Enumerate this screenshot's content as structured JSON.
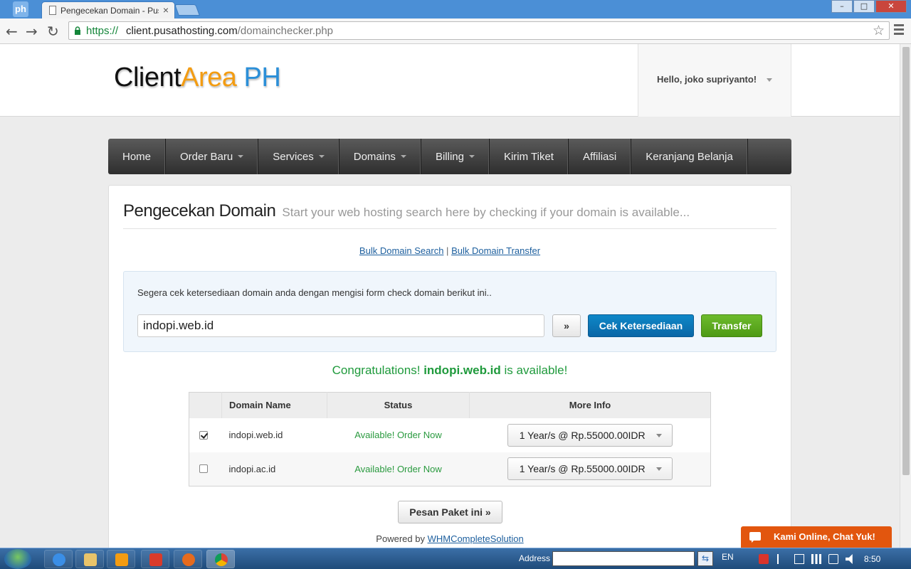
{
  "browser": {
    "tab_title": "Pengecekan Domain - Pus",
    "tab_close": "×",
    "url_scheme": "https://",
    "url_host": "client.pusathosting.com",
    "url_path": "/domainchecker.php",
    "app_icon": "ph",
    "win_min": "–",
    "win_max": "□",
    "win_close": "✕"
  },
  "header": {
    "logo_part1": "Client",
    "logo_part2": "Area",
    "logo_part3": "PH",
    "user_greeting": "Hello, joko supriyanto!"
  },
  "nav": {
    "items": [
      {
        "label": "Home",
        "dropdown": false
      },
      {
        "label": "Order Baru",
        "dropdown": true
      },
      {
        "label": "Services",
        "dropdown": true
      },
      {
        "label": "Domains",
        "dropdown": true
      },
      {
        "label": "Billing",
        "dropdown": true
      },
      {
        "label": "Kirim Tiket",
        "dropdown": false
      },
      {
        "label": "Affiliasi",
        "dropdown": false
      },
      {
        "label": "Keranjang Belanja",
        "dropdown": false
      }
    ]
  },
  "page": {
    "title": "Pengecekan Domain",
    "subtitle": "Start your web hosting search here by checking if your domain is available...",
    "bulk_search": "Bulk Domain Search",
    "bulk_separator": "|",
    "bulk_transfer": "Bulk Domain Transfer"
  },
  "search": {
    "intro": "Segera cek ketersediaan domain anda dengan mengisi form check domain berikut ini..",
    "domain_value": "indopi.web.id",
    "more_label": "»",
    "check_label": "Cek Ketersediaan",
    "transfer_label": "Transfer"
  },
  "result": {
    "prefix": "Congratulations!",
    "domain": "indopi.web.id",
    "suffix": "is available!"
  },
  "table": {
    "headers": [
      "Domain Name",
      "Status",
      "More Info"
    ],
    "rows": [
      {
        "checked": true,
        "domain": "indopi.web.id",
        "status": "Available! Order Now",
        "price": "1 Year/s @ Rp.55000.00IDR"
      },
      {
        "checked": false,
        "domain": "indopi.ac.id",
        "status": "Available! Order Now",
        "price": "1 Year/s @ Rp.55000.00IDR"
      }
    ]
  },
  "order_button": "Pesan Paket ini »",
  "footer": {
    "powered_prefix": "Powered by",
    "powered_link": "WHMCompleteSolution"
  },
  "chat": {
    "label": "Kami Online, Chat Yuk!"
  },
  "taskbar": {
    "address_label": "Address",
    "address_go": "⇆",
    "language": "EN",
    "time": "8:50"
  },
  "colors": {
    "accent_blue": "#0a66a6",
    "accent_green": "#4e9a15",
    "success_text": "#1f9a3c",
    "chat_orange": "#e2560e",
    "nav_dark": "#2e2e2e"
  }
}
